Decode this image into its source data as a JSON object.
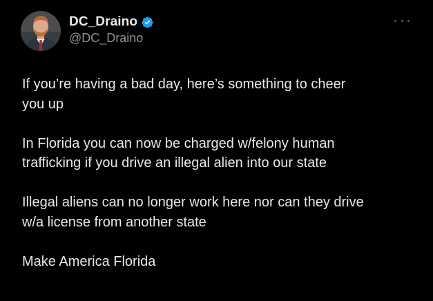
{
  "colors": {
    "background": "#000000",
    "text": "#e7e9ea",
    "secondary_text": "#8b949b",
    "verified_badge": "#1d9bf0"
  },
  "author": {
    "display_name": "DC_Draino",
    "handle": "@DC_Draino",
    "verified_icon": "verified-badge-icon",
    "avatar_icon": "user-avatar"
  },
  "menu": {
    "icon": "more-options-icon"
  },
  "tweet": {
    "paragraphs": [
      "If you’re having a bad day, here’s something to cheer\nyou up",
      "In Florida you can now be charged w/felony human\ntrafficking if you drive an illegal alien into our state",
      "Illegal aliens can no longer work here nor can they drive\nw/a license from another state",
      "Make America Florida"
    ]
  }
}
